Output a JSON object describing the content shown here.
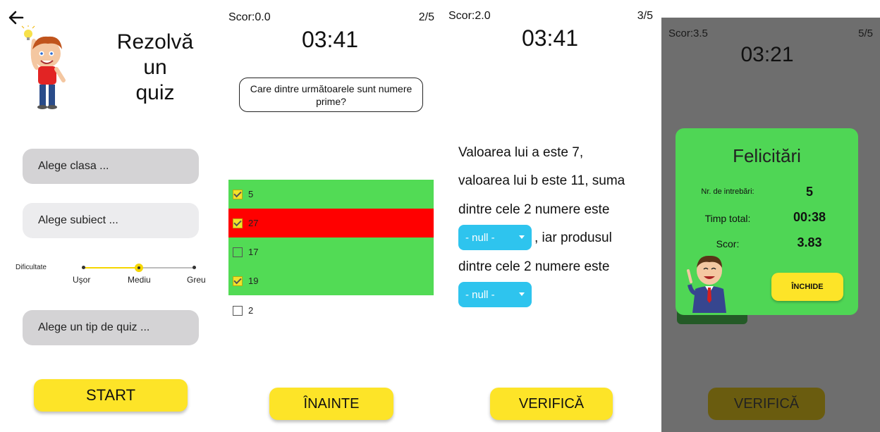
{
  "screen1": {
    "title_lines": [
      "Rezolvă",
      "un",
      "quiz"
    ],
    "select_class": "Alege clasa ...",
    "select_subject": "Alege subiect ...",
    "difficulty_label": "Dificultate",
    "difficulty_levels": [
      "Uşor",
      "Mediu",
      "Greu"
    ],
    "difficulty_selected": "Mediu",
    "select_quiz_type": "Alege un tip de quiz ...",
    "start_label": "START"
  },
  "screen2": {
    "score": "Scor:0.0",
    "question_number": "2/5",
    "timer": "03:41",
    "question": "Care dintre următoarele sunt numere prime?",
    "options": [
      {
        "text": "5",
        "checked": true,
        "state": "correct"
      },
      {
        "text": "27",
        "checked": true,
        "state": "wrong"
      },
      {
        "text": "17",
        "checked": false,
        "state": "correct"
      },
      {
        "text": "19",
        "checked": true,
        "state": "correct"
      },
      {
        "text": "2",
        "checked": false,
        "state": "neutral"
      }
    ],
    "next_label": "ÎNAINTE"
  },
  "screen3": {
    "score": "Scor:2.0",
    "question_number": "3/5",
    "timer": "03:41",
    "line1": "Valoarea lui a este 7,",
    "line2": "valoarea lui b este 11, suma",
    "line3": "dintre cele 2 numere este",
    "dropdown1": "- null -",
    "line4_tail": ", iar produsul",
    "line5": "dintre cele 2 numere este",
    "dropdown2": "- null -",
    "verify_label": "VERIFICĂ"
  },
  "screen4": {
    "score": "Scor:3.5",
    "question_number": "5/5",
    "timer": "03:21",
    "dialog_title": "Felicitări",
    "questions_label": "Nr. de intrebări:",
    "questions_value": "5",
    "time_label": "Timp total:",
    "time_value": "00:38",
    "score_label": "Scor:",
    "score_value": "3.83",
    "close_label": "ÎNCHIDE",
    "verify_label": "VERIFICĂ"
  },
  "colors": {
    "accent_yellow": "#fde428",
    "correct_green": "#52db55",
    "wrong_red": "#ff0000",
    "dropdown_blue": "#2ec4ee",
    "overlay_gray": "#6e6e6e",
    "dialog_green": "#4fd655"
  }
}
